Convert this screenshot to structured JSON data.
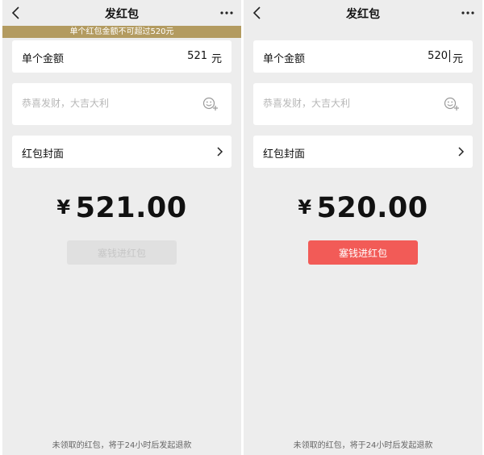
{
  "colors": {
    "page_bg": "#ededed",
    "warning_bg": "#b39b60",
    "button_active": "#f25b57",
    "button_disabled": "#e0e0e0"
  },
  "left": {
    "nav": {
      "title": "发红包",
      "back_icon": "chevron-left-icon",
      "more_icon": "more-dots-icon"
    },
    "warning": "单个红包金额不可超过520元",
    "amount": {
      "label": "单个金额",
      "value": "521",
      "unit": "元"
    },
    "greeting": {
      "placeholder": "恭喜发财，大吉大利",
      "emoji_icon": "emoji-add-icon"
    },
    "cover": {
      "label": "红包封面",
      "chevron_icon": "chevron-right-icon"
    },
    "total": {
      "symbol": "¥",
      "value": "521.00"
    },
    "send_button": {
      "label": "塞钱进红包",
      "state": "disabled"
    },
    "footer": "未领取的红包，将于24小时后发起退款"
  },
  "right": {
    "nav": {
      "title": "发红包",
      "back_icon": "chevron-left-icon",
      "more_icon": "more-dots-icon"
    },
    "amount": {
      "label": "单个金额",
      "value": "520",
      "unit": "元"
    },
    "greeting": {
      "placeholder": "恭喜发财，大吉大利",
      "emoji_icon": "emoji-add-icon"
    },
    "cover": {
      "label": "红包封面",
      "chevron_icon": "chevron-right-icon"
    },
    "total": {
      "symbol": "¥",
      "value": "520.00"
    },
    "send_button": {
      "label": "塞钱进红包",
      "state": "active"
    },
    "footer": "未领取的红包，将于24小时后发起退款"
  }
}
